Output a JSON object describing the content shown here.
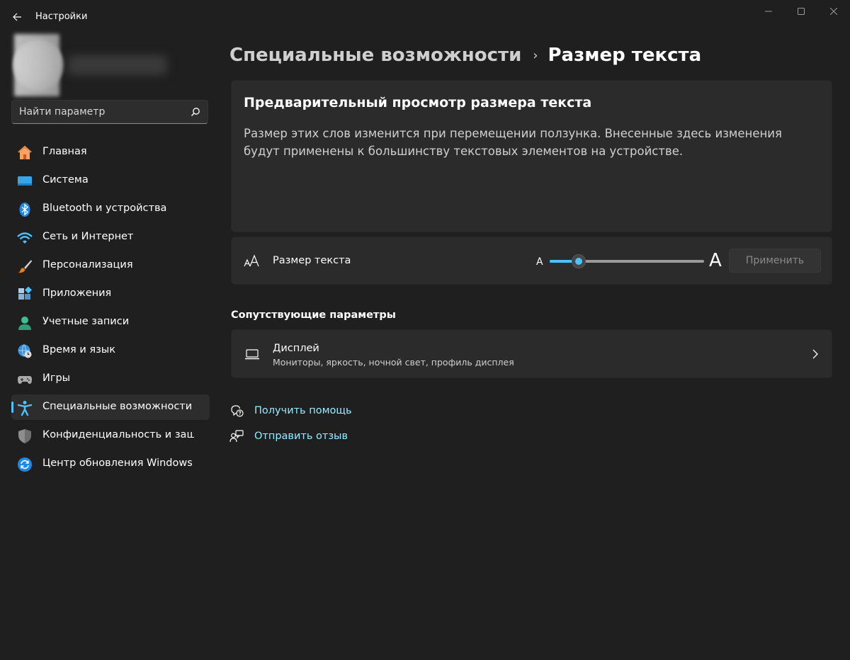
{
  "window": {
    "title": "Настройки",
    "icons": {
      "back": "back-arrow-icon",
      "minimize": "minimize-icon",
      "maximize": "maximize-icon",
      "close": "close-icon"
    }
  },
  "search": {
    "placeholder": "Найти параметр",
    "value": ""
  },
  "sidebar": {
    "items": [
      {
        "label": "Главная",
        "icon": "home-icon"
      },
      {
        "label": "Система",
        "icon": "system-icon"
      },
      {
        "label": "Bluetooth и устройства",
        "icon": "bluetooth-icon"
      },
      {
        "label": "Сеть и Интернет",
        "icon": "wifi-icon"
      },
      {
        "label": "Персонализация",
        "icon": "brush-icon"
      },
      {
        "label": "Приложения",
        "icon": "apps-icon"
      },
      {
        "label": "Учетные записи",
        "icon": "account-icon"
      },
      {
        "label": "Время и язык",
        "icon": "globe-clock-icon"
      },
      {
        "label": "Игры",
        "icon": "gamepad-icon"
      },
      {
        "label": "Специальные возможности",
        "icon": "accessibility-icon",
        "active": true
      },
      {
        "label": "Конфиденциальность и защита",
        "icon": "shield-icon"
      },
      {
        "label": "Центр обновления Windows",
        "icon": "update-icon"
      }
    ]
  },
  "breadcrumb": {
    "parent": "Специальные возможности",
    "separator": "›",
    "current": "Размер текста"
  },
  "preview": {
    "title": "Предварительный просмотр размера текста",
    "text": "Размер этих слов изменится при перемещении ползунка. Внесенные здесь изменения будут применены к большинству текстовых элементов на устройстве."
  },
  "text_size": {
    "label": "Размер текста",
    "icon": "text-size-icon",
    "small_marker": "A",
    "large_marker": "A",
    "slider_value": 0.19,
    "apply_label": "Применить"
  },
  "related": {
    "title": "Сопутствующие параметры",
    "display": {
      "title": "Дисплей",
      "subtitle": "Мониторы, яркость, ночной свет, профиль дисплея",
      "icon": "laptop-icon"
    }
  },
  "links": {
    "help": {
      "label": "Получить помощь",
      "icon": "help-icon"
    },
    "feedback": {
      "label": "Отправить отзыв",
      "icon": "feedback-icon"
    }
  },
  "colors": {
    "accent": "#4cc2ff",
    "link": "#99ebff",
    "background": "#1f1f1f",
    "card": "#2b2b2b"
  }
}
